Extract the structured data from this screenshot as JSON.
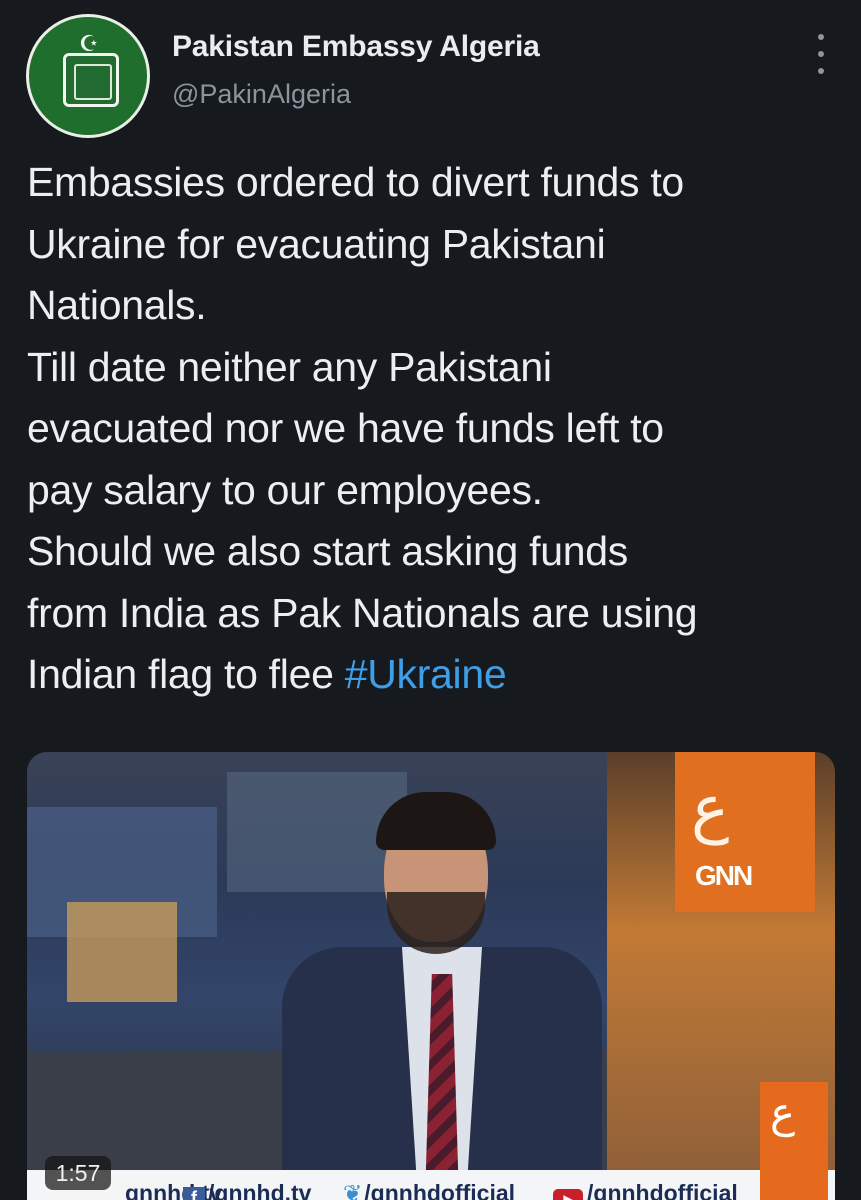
{
  "account": {
    "name": "Pakistan Embassy Algeria",
    "handle": "@PakinAlgeria",
    "avatar_icon": "embassy-seal-icon"
  },
  "tweet": {
    "lines": [
      "Embassies ordered to divert funds to",
      "Ukraine for evacuating Pakistani",
      "Nationals.",
      "Till date neither any Pakistani",
      "evacuated nor we have funds left to",
      "pay salary to our employees.",
      "Should we also start asking funds",
      "from India as Pak Nationals are using"
    ],
    "last_line_prefix": "Indian flag to flee ",
    "hashtag": "#Ukraine"
  },
  "video": {
    "duration": "1:57",
    "ticker": {
      "site": "gnnhd.tv",
      "facebook": "/gnnhd.tv",
      "twitter": "/gnnhdofficial",
      "youtube": "/gnnhdofficial"
    },
    "channel_logo": "GNN"
  },
  "colors": {
    "background": "#16191d",
    "hashtag": "#3e9ee6",
    "text": "#eceef0",
    "handle": "#8b949c"
  }
}
